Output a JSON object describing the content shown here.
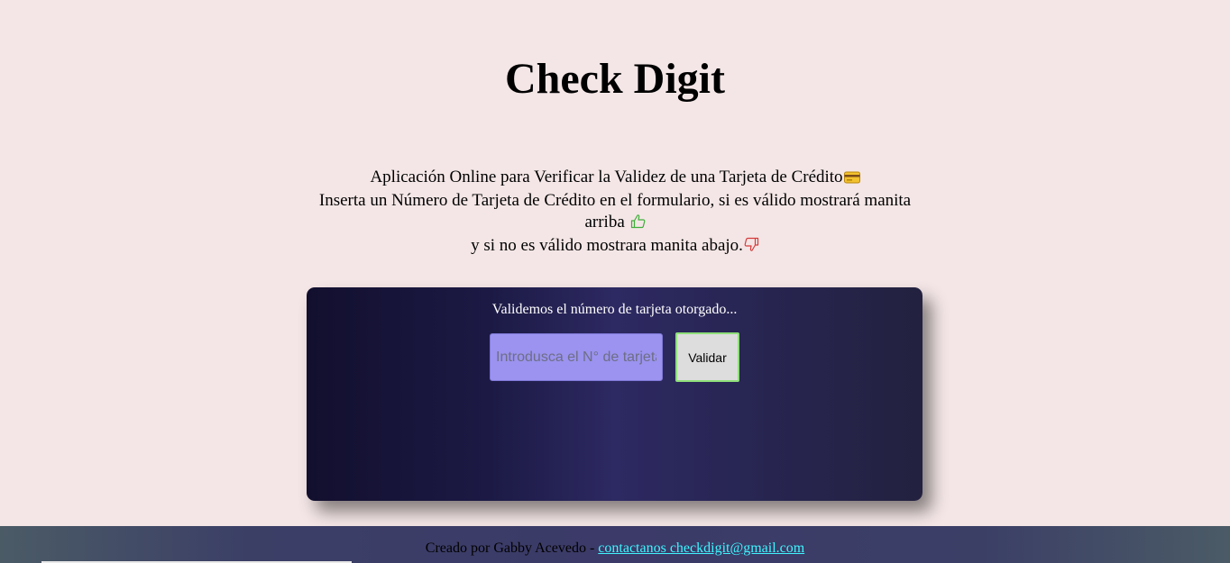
{
  "header": {
    "title": "Check Digit"
  },
  "intro": {
    "line1": "Aplicación Online para Verificar la Validez de una Tarjeta de Crédito",
    "line2": "Inserta un Número de Tarjeta de Crédito en el formulario, si es válido mostrará manita arriba",
    "line3": "y si no es válido mostrara manita abajo.",
    "icons": {
      "card": "credit-card-icon",
      "up": "thumbs-up-icon",
      "down": "thumbs-down-icon"
    }
  },
  "form": {
    "heading": "Validemos el número de tarjeta otorgado...",
    "input_placeholder": "Introdusca el N° de tarjeta:",
    "input_value": "",
    "button_label": "Validar"
  },
  "footer": {
    "text": "Creado por Gabby Acevedo - ",
    "link_text": "contactanos checkdigit@gmail.com"
  },
  "colors": {
    "background": "#f4e6e6",
    "input_bg": "#9b93ef",
    "button_border": "#8fe07a",
    "link": "#3ff5ff"
  }
}
